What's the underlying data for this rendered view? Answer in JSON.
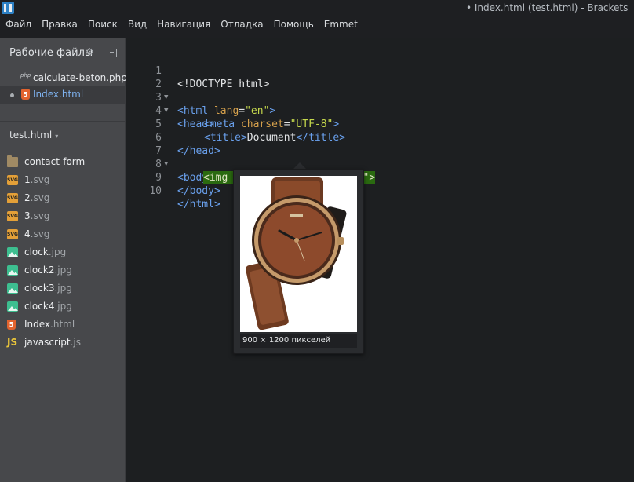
{
  "window": {
    "title": "• Index.html (test.html) - Brackets",
    "menu": [
      "Файл",
      "Правка",
      "Поиск",
      "Вид",
      "Навигация",
      "Отладка",
      "Помощь",
      "Emmet"
    ]
  },
  "sidebar": {
    "working_files_header": "Рабочие файлы",
    "working_files": [
      {
        "ext_tag": "php",
        "name": "calculate-beton.php",
        "active": false
      },
      {
        "name": "Index.html",
        "active": true,
        "icon": "html5-icon"
      }
    ],
    "project_name": "test.html",
    "project_caret": "▾",
    "tree": [
      {
        "name": "contact-form",
        "ext": "",
        "icon": "folder-icon"
      },
      {
        "name": "1",
        "ext": ".svg",
        "icon": "svg-file-icon"
      },
      {
        "name": "2",
        "ext": ".svg",
        "icon": "svg-file-icon"
      },
      {
        "name": "3",
        "ext": ".svg",
        "icon": "svg-file-icon"
      },
      {
        "name": "4",
        "ext": ".svg",
        "icon": "svg-file-icon"
      },
      {
        "name": "clock",
        "ext": ".jpg",
        "icon": "image-file-icon"
      },
      {
        "name": "clock2",
        "ext": ".jpg",
        "icon": "image-file-icon"
      },
      {
        "name": "clock3",
        "ext": ".jpg",
        "icon": "image-file-icon"
      },
      {
        "name": "clock4",
        "ext": ".jpg",
        "icon": "image-file-icon"
      },
      {
        "name": "Index",
        "ext": ".html",
        "icon": "html5-icon"
      },
      {
        "name": "javascript",
        "ext": ".js",
        "icon": "js-file-icon"
      }
    ]
  },
  "editor": {
    "line_numbers": [
      "1",
      "2",
      "3",
      "4",
      "5",
      "6",
      "7",
      "8",
      "9",
      "10"
    ],
    "lines": [
      "<!DOCTYPE html>",
      "<html lang=\"en\">",
      "<head>",
      "<meta charset=\"UTF-8\">",
      "<title>Document</title>",
      "</head>",
      "<body>",
      "<img src=\"clock.jpg\" alt=\"\">",
      "</body>",
      "</html>"
    ],
    "tokens": {
      "l1": "<!DOCTYPE html>",
      "l2a": "<html",
      "l2b": " lang",
      "l2c": "=",
      "l2d": "\"en\"",
      "l2e": ">",
      "l3": "<head>",
      "l4a": "<meta",
      "l4b": " charset",
      "l4c": "=",
      "l4d": "\"UTF-8\"",
      "l4e": ">",
      "l5a": "<title>",
      "l5b": "Document",
      "l5c": "</title>",
      "l6": "</head>",
      "l7": "<body>",
      "l8": "<img src=\"clock.jpg\" alt=\"\">",
      "l9": "</body>",
      "l10": "</html>"
    },
    "fold_glyph": "▼",
    "image_preview": {
      "caption": "900 × 1200 пикселей",
      "image_subject": "wristwatch photo"
    }
  },
  "colors": {
    "accent_blue": "#6aa1ee",
    "attribute": "#d5a04c",
    "string": "#c5d84c",
    "selection": "#2a6a10"
  }
}
